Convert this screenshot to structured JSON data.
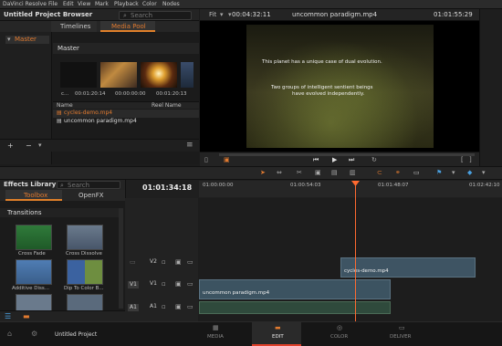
{
  "menu": {
    "app": "DaVinci Resolve",
    "items": [
      "File",
      "Edit",
      "View",
      "Mark",
      "Playback",
      "Color",
      "Nodes"
    ]
  },
  "media_browser": {
    "title": "Untitled Project Browser",
    "search_placeholder": "Search",
    "tabs": [
      "Timelines",
      "Media Pool"
    ],
    "active_tab": "Media Pool",
    "bin": "Master",
    "pool_title": "Master",
    "thumb_labels": [
      {
        "name": "c...",
        "tc": "00:01:20:14"
      },
      {
        "name": "",
        "tc": "00:00:00:00"
      },
      {
        "name": "",
        "tc": "00:01:20:13"
      }
    ],
    "columns": [
      "Name",
      "Reel Name"
    ],
    "files": [
      "cycles-demo.mp4",
      "uncommon paradigm.mp4"
    ],
    "bottom_buttons": [
      "+",
      "−"
    ]
  },
  "viewer": {
    "fit": "Fit",
    "timecode_left": "00:04:32:11",
    "clip_name": "uncommon paradigm.mp4",
    "timecode_right": "01:01:55:29",
    "subtitle_line1": "This planet has a unique case of dual evolution.",
    "subtitle_line2a": "Two groups of intelligent sentient beings",
    "subtitle_line2b": "have evolved independently."
  },
  "effects": {
    "title": "Effects Library",
    "search_placeholder": "Search",
    "tabs": [
      "Toolbox",
      "OpenFX"
    ],
    "active_tab": "Toolbox",
    "section": "Transitions",
    "items": [
      "Cross Fade",
      "Cross Dissolve",
      "Additive Diss...",
      "Dip To Color B..."
    ]
  },
  "timeline": {
    "current_tc": "01:01:34:18",
    "ruler": [
      "01:00:00:00",
      "01:00:54:03",
      "01:01:48:07",
      "01:02:42:10"
    ],
    "tracks": [
      "V2",
      "V1",
      "A1"
    ],
    "clips": {
      "v2": "cycles-demo.mp4",
      "v1": "uncommon paradigm.mp4"
    }
  },
  "footer": {
    "project": "Untitled Project",
    "pages": [
      "MEDIA",
      "EDIT",
      "COLOR",
      "DELIVER"
    ],
    "active_page": "EDIT"
  },
  "colors": {
    "accent": "#e07a30",
    "playhead": "#ff6a30",
    "clip": "#3e5463"
  }
}
